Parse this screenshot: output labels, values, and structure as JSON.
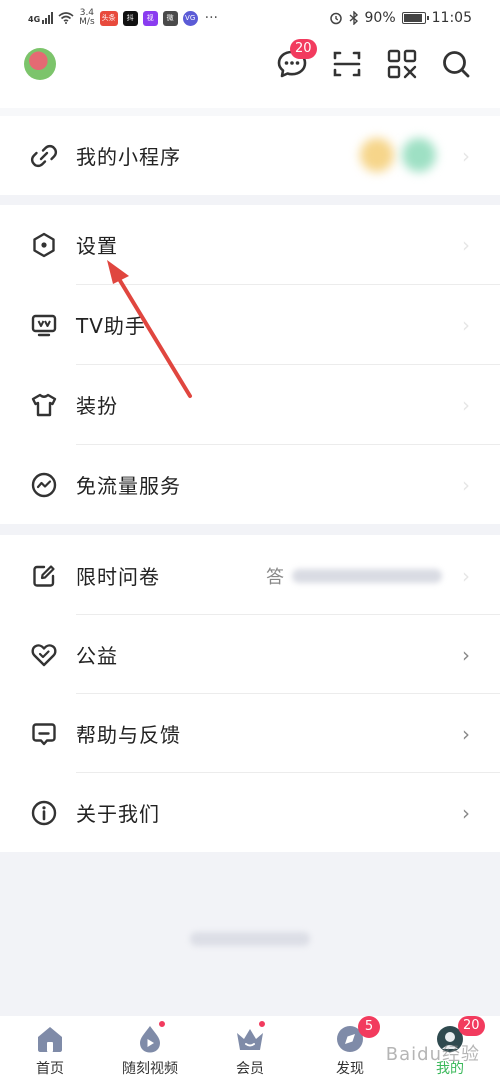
{
  "status_bar": {
    "network": "4G",
    "speed_value": "3.4",
    "speed_unit": "M/s",
    "battery": "90%",
    "time": "11:05",
    "app_icons": [
      "头条",
      "抖",
      "视",
      "微",
      "VG"
    ]
  },
  "header": {
    "message_badge": "20"
  },
  "menu": {
    "mini_programs": "我的小程序",
    "settings": "设置",
    "tv_assistant": "TV助手",
    "dress_up": "装扮",
    "free_data": "免流量服务",
    "survey": "限时问卷",
    "survey_aside": "答",
    "charity": "公益",
    "help": "帮助与反馈",
    "about": "关于我们",
    "chevron": "›"
  },
  "bottom_nav": {
    "home": "首页",
    "video": "随刻视频",
    "vip": "会员",
    "discover": "发现",
    "discover_badge": "5",
    "mine": "我的",
    "mine_badge": "20"
  },
  "watermark": "Baidu经验",
  "colors": {
    "accent_green": "#3ab85a",
    "badge_red": "#f23b5e",
    "arrow_red": "#e0463f",
    "separator": "#f2f3f7"
  }
}
